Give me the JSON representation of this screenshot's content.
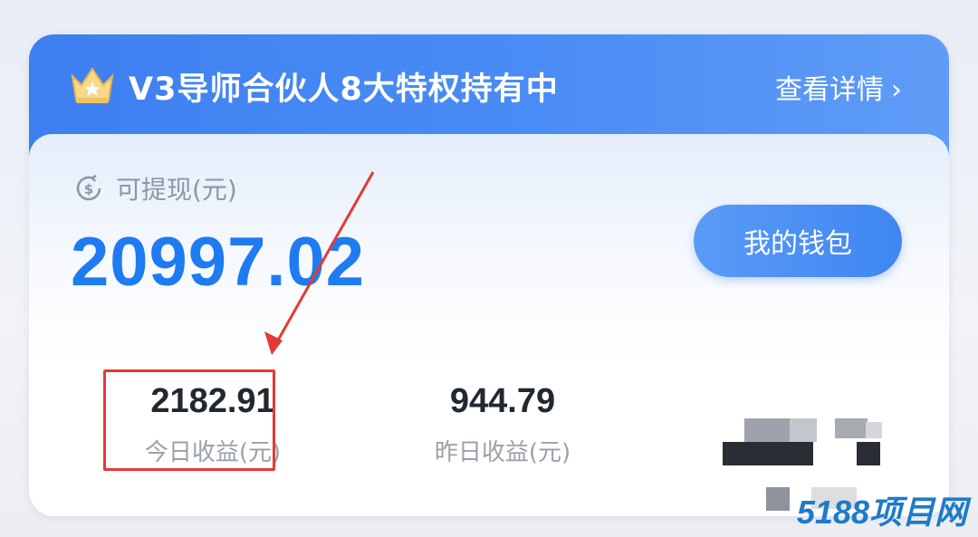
{
  "header": {
    "title": "V3导师合伙人8大特权持有中",
    "details_label": "查看详情",
    "crown_icon": "crown-icon"
  },
  "balance": {
    "label": "可提现(元)",
    "amount": "20997.02",
    "icon": "coin-withdraw-icon"
  },
  "wallet_button": {
    "label": "我的钱包"
  },
  "stats": {
    "today": {
      "value": "2182.91",
      "label": "今日收益(元)"
    },
    "yesterday": {
      "value": "944.79",
      "label": "昨日收益(元)"
    }
  },
  "watermark": "5188项目网",
  "colors": {
    "header_blue": "#3d7ff0",
    "amount_blue": "#1e7bf2",
    "annotation_red": "#e53935",
    "crown_gold": "#f3c25a"
  }
}
